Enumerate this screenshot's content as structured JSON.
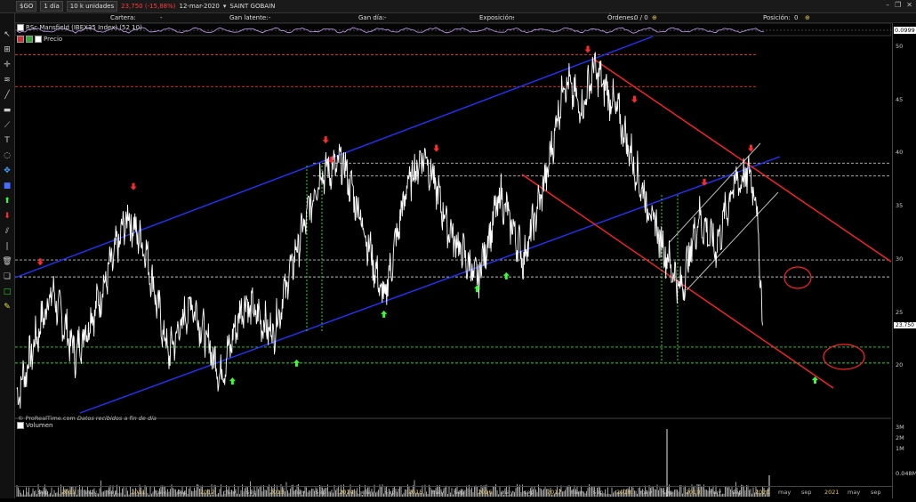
{
  "toolbar": {
    "symbol": "$GO",
    "timeframe": "1 día",
    "units": "10 k unidades",
    "price": "23,750",
    "change": "(-15,88%)",
    "date": "12-mar-2020",
    "instrument": "SAINT GOBAIN"
  },
  "account": {
    "cartera_label": "Cartera:",
    "cartera_value": "-",
    "gan_latente_label": "Gan latente:",
    "gan_latente_value": "-",
    "gan_dia_label": "Gan día:",
    "gan_dia_value": "-",
    "exposicion_label": "Exposición:",
    "exposicion_value": "-",
    "ordenes_label": "Órdenes:",
    "ordenes_value": "0 / 0",
    "posicion_label": "Posición:",
    "posicion_value": "0"
  },
  "panels": {
    "rsc_label": "RSc Mansfield (IBEX35 Index) (52 10)",
    "rsc_value": "0.0999",
    "price_label": "Precio",
    "price_tag": "23.750",
    "volume_label": "Volumen",
    "volume_ticks": [
      "3M",
      "2M",
      "1M",
      "0.048M"
    ],
    "credit": "© ProRealTime.com",
    "credit_note": "Datos recibidos a fin de día"
  },
  "chart_data": {
    "type": "line",
    "title": "",
    "y_ticks": [
      50,
      45,
      40,
      35,
      30,
      25,
      20
    ],
    "ylim": [
      15.5,
      50.5
    ],
    "x_labels": [
      "sep",
      "2010",
      "may",
      "sep",
      "2011",
      "may",
      "sep",
      "2012",
      "may",
      "sep",
      "2013",
      "may",
      "sep",
      "2014",
      "may",
      "sep",
      "2015",
      "may",
      "sep",
      "2016",
      "may",
      "sep",
      "2017",
      "may",
      "sep",
      "2018",
      "may",
      "sep",
      "2019",
      "may",
      "sep",
      "2020",
      "may",
      "sep",
      "2021",
      "may",
      "sep"
    ],
    "price_series": [
      {
        "x": "2009-07",
        "y": 17
      },
      {
        "x": "2009-10",
        "y": 22
      },
      {
        "x": "2010-01",
        "y": 27
      },
      {
        "x": "2010-05",
        "y": 21
      },
      {
        "x": "2010-09",
        "y": 26
      },
      {
        "x": "2011-02",
        "y": 34
      },
      {
        "x": "2011-05",
        "y": 31
      },
      {
        "x": "2011-09",
        "y": 21
      },
      {
        "x": "2012-01",
        "y": 26
      },
      {
        "x": "2012-06",
        "y": 19
      },
      {
        "x": "2012-10",
        "y": 26
      },
      {
        "x": "2013-03",
        "y": 23
      },
      {
        "x": "2013-06",
        "y": 29
      },
      {
        "x": "2013-11",
        "y": 38
      },
      {
        "x": "2014-03",
        "y": 39
      },
      {
        "x": "2014-06",
        "y": 34
      },
      {
        "x": "2014-10",
        "y": 26
      },
      {
        "x": "2015-02",
        "y": 37
      },
      {
        "x": "2015-05",
        "y": 40
      },
      {
        "x": "2015-09",
        "y": 33
      },
      {
        "x": "2016-02",
        "y": 28
      },
      {
        "x": "2016-06",
        "y": 36
      },
      {
        "x": "2016-10",
        "y": 30
      },
      {
        "x": "2017-02",
        "y": 38
      },
      {
        "x": "2017-05",
        "y": 47
      },
      {
        "x": "2017-08",
        "y": 44
      },
      {
        "x": "2017-10",
        "y": 48
      },
      {
        "x": "2018-02",
        "y": 44
      },
      {
        "x": "2018-06",
        "y": 37
      },
      {
        "x": "2018-10",
        "y": 31
      },
      {
        "x": "2019-01",
        "y": 27
      },
      {
        "x": "2019-04",
        "y": 34
      },
      {
        "x": "2019-07",
        "y": 31
      },
      {
        "x": "2019-10",
        "y": 37
      },
      {
        "x": "2020-01",
        "y": 38
      },
      {
        "x": "2020-02",
        "y": 35
      },
      {
        "x": "2020-03",
        "y": 23.75
      }
    ],
    "horizontal_levels": [
      {
        "y": 49.2,
        "color": "#ff2b2b",
        "style": "dashed"
      },
      {
        "y": 46.2,
        "color": "#ff2b2b",
        "style": "dashed"
      },
      {
        "y": 39.0,
        "color": "#bbbbbb",
        "style": "dashed"
      },
      {
        "y": 37.8,
        "color": "#bbbbbb",
        "style": "dashed"
      },
      {
        "y": 29.9,
        "color": "#bbbbbb",
        "style": "dashed"
      },
      {
        "y": 28.3,
        "color": "#bbbbbb",
        "style": "dashed"
      },
      {
        "y": 21.7,
        "color": "#22dd22",
        "style": "dashed"
      },
      {
        "y": 20.2,
        "color": "#22dd22",
        "style": "dashed"
      }
    ],
    "colors": {
      "price": "#ffffff",
      "channel_blue": "#2233ff",
      "channel_red": "#ff2222",
      "support": "#22dd22",
      "up_arrow": "#35ff35",
      "down_arrow": "#ff2b2b"
    }
  }
}
